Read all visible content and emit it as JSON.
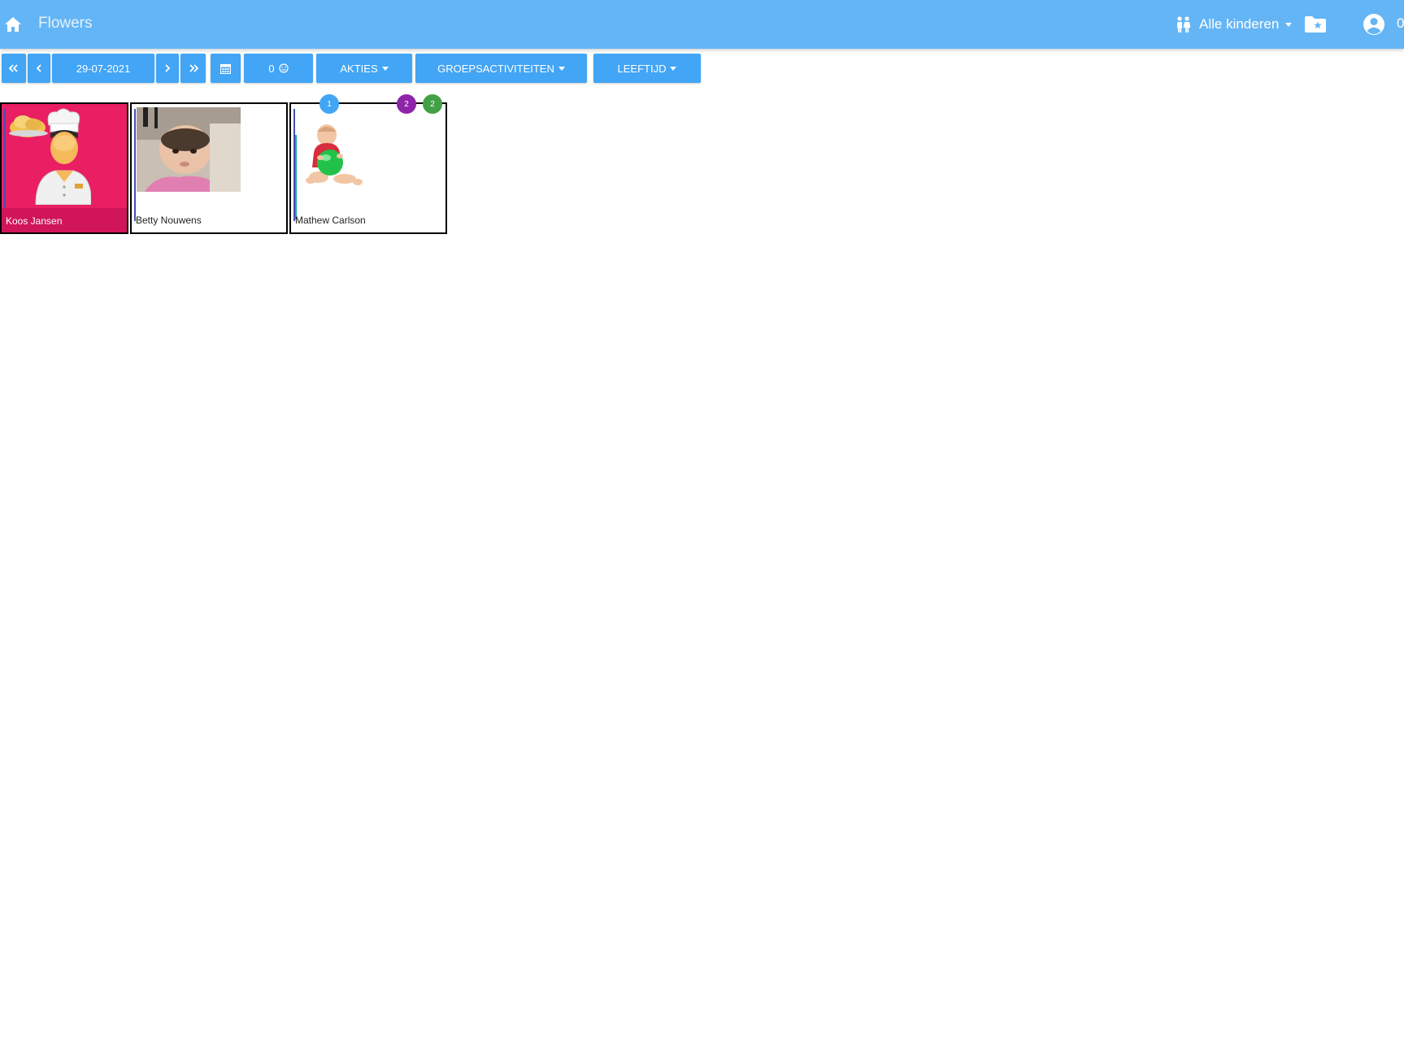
{
  "header": {
    "title": "Flowers",
    "children_filter_label": "Alle kinderen",
    "account_text": "0",
    "bar_color": "#64b5f6"
  },
  "toolbar": {
    "date": "29-07-2021",
    "counter_label": "0",
    "actions_label": "AKTIES",
    "group_activities_label": "GROEPSACTIVITEITEN",
    "age_label": "LEEFTIJD",
    "button_color": "#42a5f5"
  },
  "children": [
    {
      "name": "Koos Jansen",
      "background": "#e91e63"
    },
    {
      "name": "Betty Nouwens"
    },
    {
      "name": "Mathew Carlson"
    }
  ],
  "badges": [
    {
      "label": "1",
      "color": "#42a5f5"
    },
    {
      "label": "2",
      "color": "#8e24aa"
    },
    {
      "label": "2",
      "color": "#43a047"
    }
  ]
}
